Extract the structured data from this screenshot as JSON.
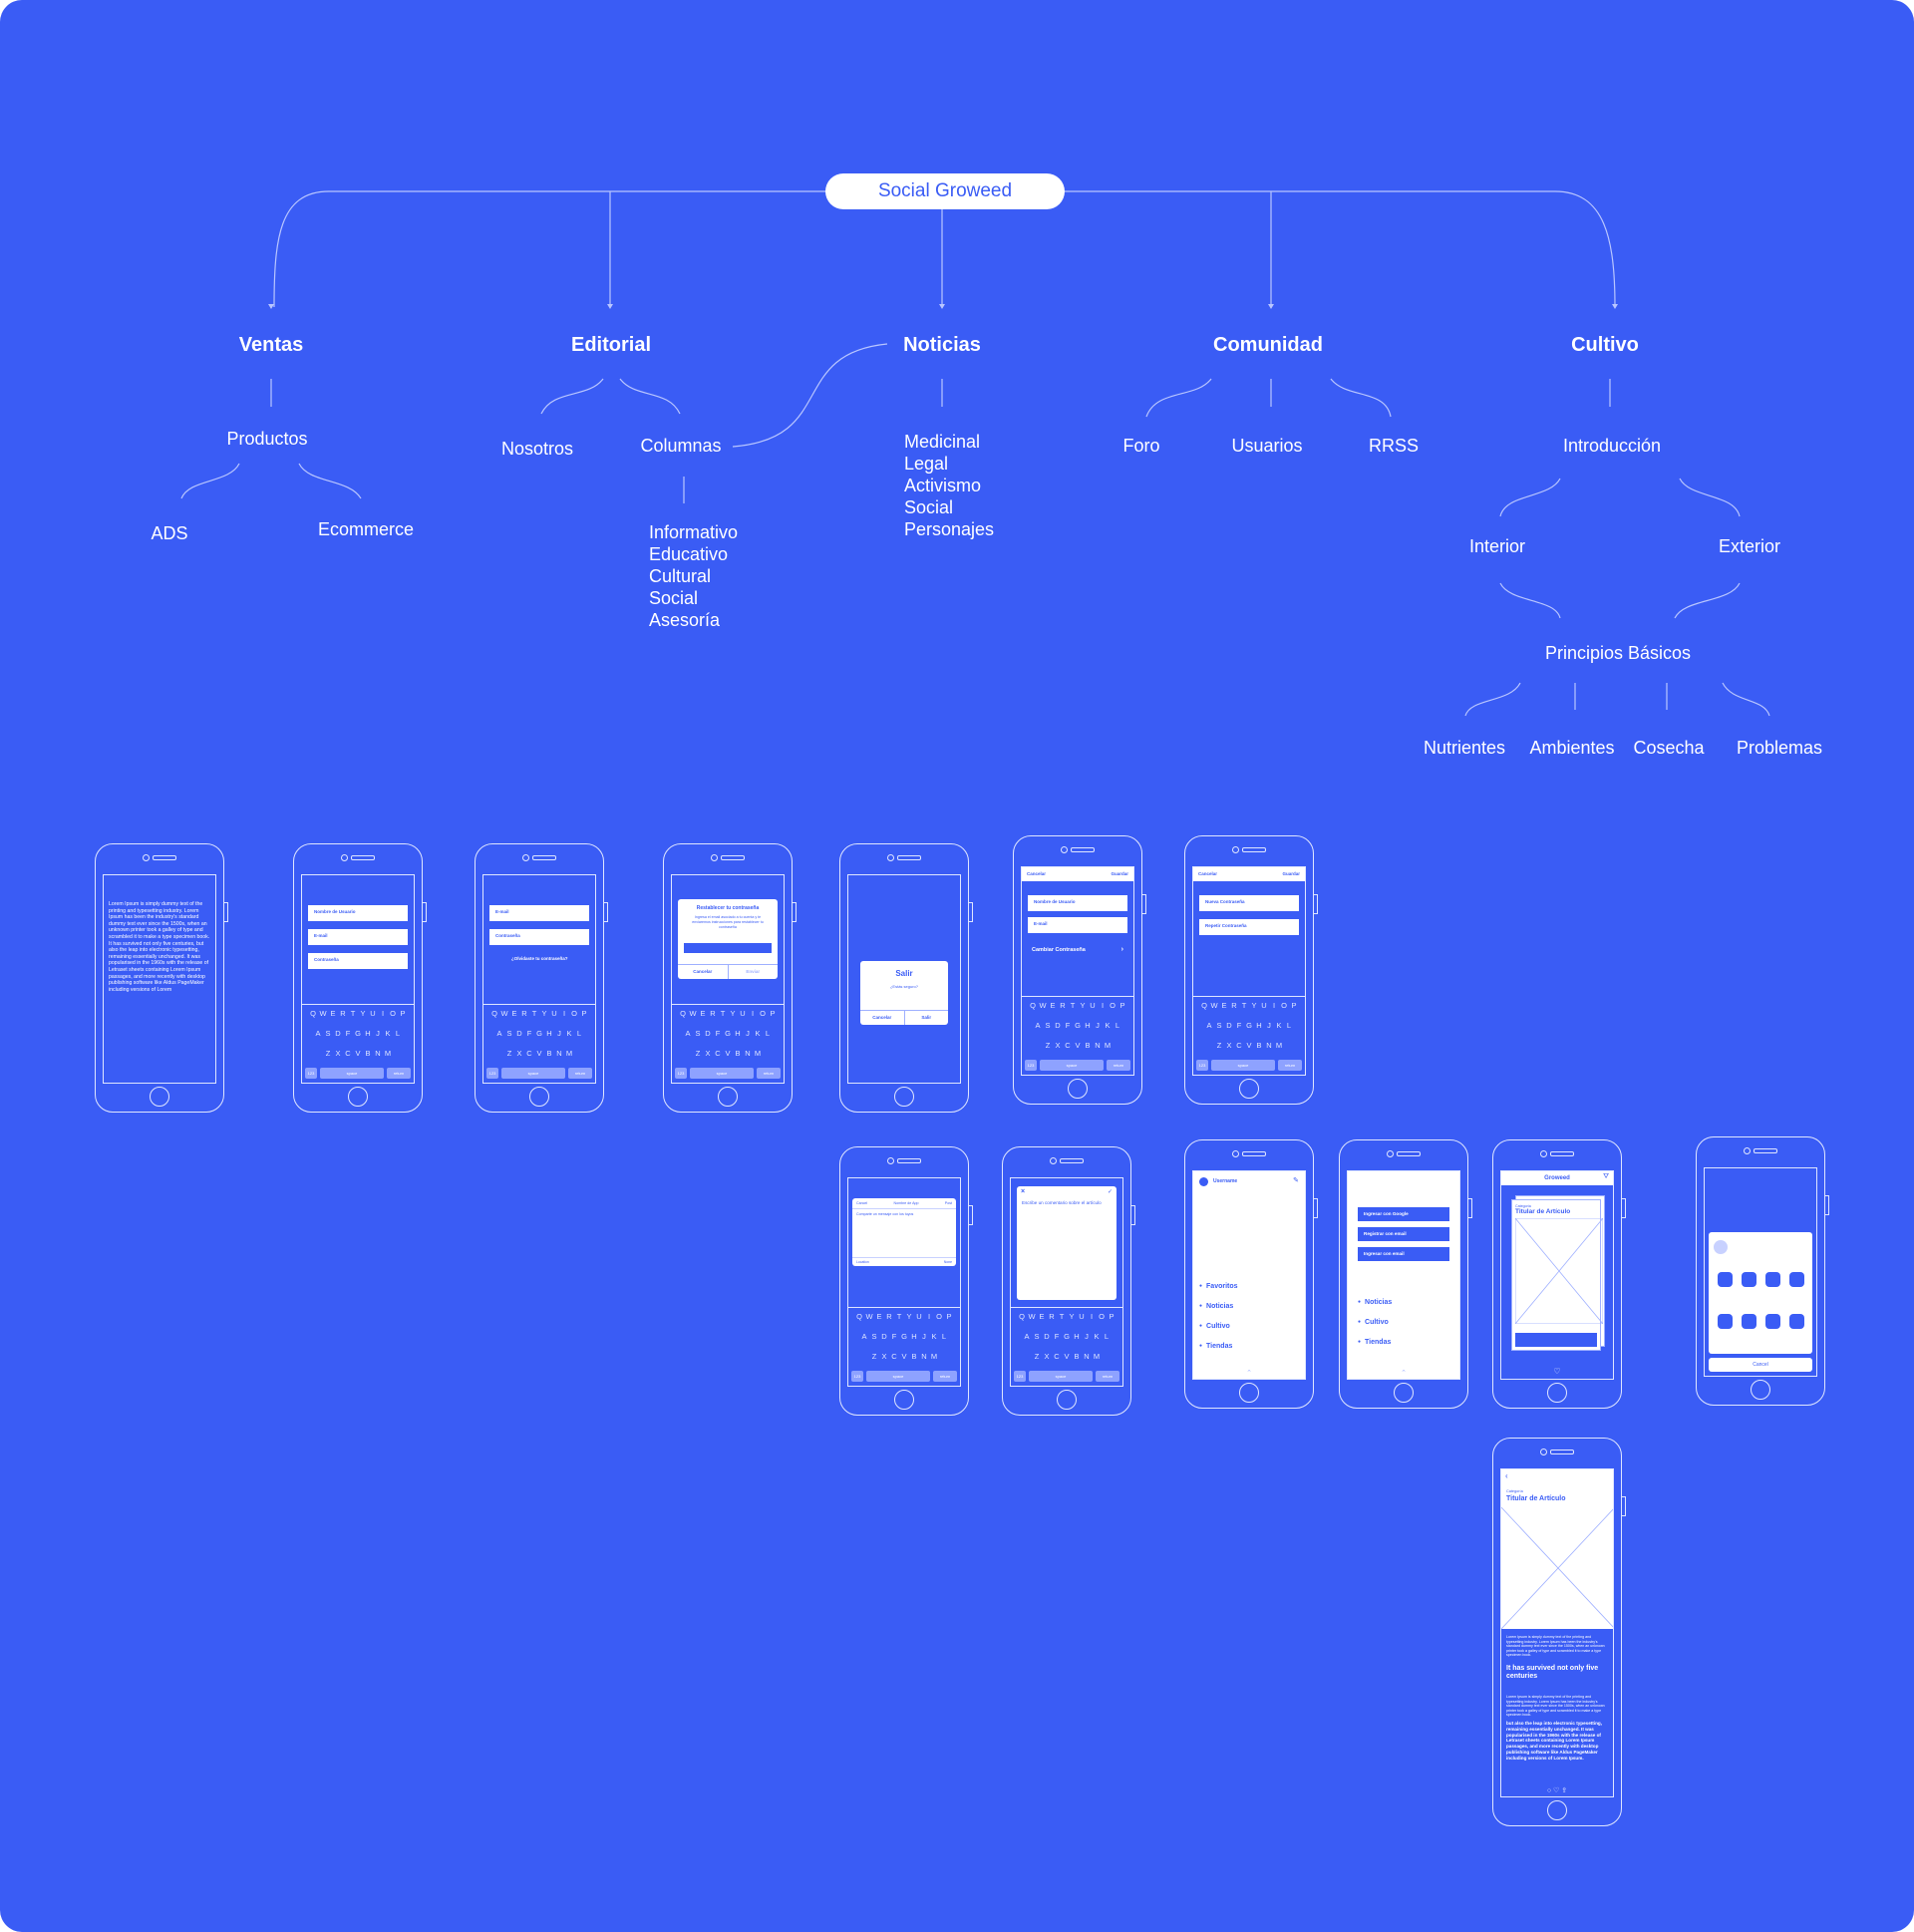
{
  "sitemap": {
    "root": "Social Groweed",
    "categories": {
      "ventas": "Ventas",
      "editorial": "Editorial",
      "noticias": "Noticias",
      "comunidad": "Comunidad",
      "cultivo": "Cultivo"
    },
    "ventas": {
      "productos": "Productos",
      "ads": "ADS",
      "ecommerce": "Ecommerce"
    },
    "editorial": {
      "nosotros": "Nosotros",
      "columnas": "Columnas",
      "columnas_items": [
        "Informativo",
        "Educativo",
        "Cultural",
        "Social",
        "Asesoría"
      ]
    },
    "noticias": {
      "items": [
        "Medicinal",
        "Legal",
        "Activismo",
        "Social",
        "Personajes"
      ]
    },
    "comunidad": {
      "foro": "Foro",
      "usuarios": "Usuarios",
      "rrss": "RRSS"
    },
    "cultivo": {
      "introduccion": "Introducción",
      "interior": "Interior",
      "exterior": "Exterior",
      "principios": "Principios Básicos",
      "nutrientes": "Nutrientes",
      "ambientes": "Ambientes",
      "cosecha": "Cosecha",
      "problemas": "Problemas"
    }
  },
  "wireframes": {
    "lorem_short": "Lorem Ipsum is simply dummy text of the printing and typesetting industry. Lorem Ipsum has been the industry's standard dummy text ever since the 1500s, when an unknown printer took a galley of type and scrambled it to make a type specimen book. It has survived not only five centuries, but also the leap into electronic typesetting, remaining essentially unchanged. It was popularised in the 1960s with the release of Letraset sheets containing Lorem Ipsum passages, and more recently with desktop publishing software like Aldus PageMaker including versions of Lorem",
    "fields": {
      "nombre": "Nombre de Usuario",
      "email": "E-mail",
      "password": "Contraseña",
      "forgot": "¿Olvidaste tu contraseña?",
      "nueva": "Nueva Contraseña",
      "repetir": "Repetir Contraseña",
      "cambiar": "Cambiar Contraseña"
    },
    "actions": {
      "cancelar": "Cancelar",
      "guardar": "Guardar",
      "enviar": "Enviar",
      "salir": "Salir",
      "estas_seguro": "¿Estás seguro?",
      "cancel": "Cancel"
    },
    "restablecer": {
      "title": "Restablecer tu contraseña",
      "body": "Ingresa el email asociado a tu cuenta y te enviaremos instrucciones para restablecer tu contraseña"
    },
    "keyboard": {
      "row1": [
        "Q",
        "W",
        "E",
        "R",
        "T",
        "Y",
        "U",
        "I",
        "O",
        "P"
      ],
      "row2": [
        "A",
        "S",
        "D",
        "F",
        "G",
        "H",
        "J",
        "K",
        "L"
      ],
      "row3": [
        "Z",
        "X",
        "C",
        "V",
        "B",
        "N",
        "M"
      ],
      "space": "space",
      "return": "return",
      "num": "123"
    },
    "share": {
      "cancel": "Cancel",
      "app": "Nombre de App",
      "post": "Post",
      "placeholder": "Comparte un mensaje con los tuyos",
      "location": "Location",
      "none": "None"
    },
    "comentario": "Escribe un comentario sobre el artículo",
    "navegacion": {
      "username": "Username",
      "items": [
        "Favoritos",
        "Noticias",
        "Cultivo",
        "Tiendas"
      ],
      "items_log": [
        "Noticias",
        "Cultivo",
        "Tiendas"
      ],
      "google": "Ingresar con Google",
      "registrar": "Registrar con email",
      "ingresar": "Ingresar con email"
    },
    "feed": {
      "brand": "Groweed",
      "categoria": "Categoría",
      "titular": "Titular de Artículo"
    },
    "article": {
      "categoria": "Categoría",
      "titular": "Titular de Artículo",
      "heading": "It has survived not only five centuries",
      "para": "Lorem Ipsum is simply dummy text of the printing and typesetting industry. Lorem Ipsum has been the industry's standard dummy text ever since the 1500s, when an unknown printer took a galley of type and scrambled it to make a type specimen book.",
      "para2": "but also the leap into electronic typesetting, remaining essentially unchanged. It was popularised in the 1960s with the release of Letraset sheets containing Lorem Ipsum passages, and more recently with desktop publishing software like Aldus PageMaker including versions of Lorem Ipsum."
    }
  }
}
